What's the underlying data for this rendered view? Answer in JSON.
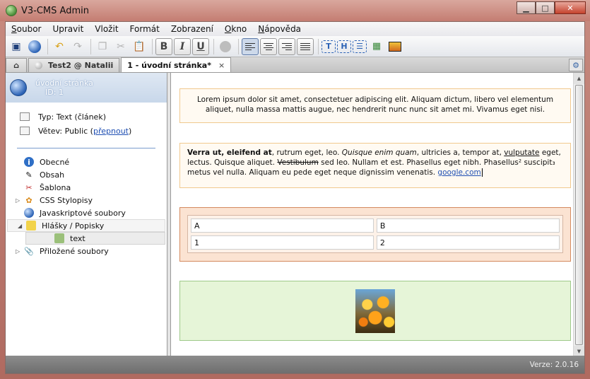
{
  "window": {
    "title": "V3-CMS Admin",
    "minimize": "▁",
    "maximize": "□",
    "close": "✕"
  },
  "menu": [
    {
      "pre": "S",
      "rest": "oubor"
    },
    {
      "pre": "",
      "rest": "Upravit"
    },
    {
      "pre": "",
      "rest": "Vložit"
    },
    {
      "pre": "",
      "rest": "Formát"
    },
    {
      "pre": "",
      "rest": "Zobrazení"
    },
    {
      "pre": "O",
      "rest": "kno"
    },
    {
      "pre": "N",
      "rest": "ápověda"
    }
  ],
  "toolbar": {
    "bold": "B",
    "italic": "I",
    "underline": "U",
    "icons": [
      "save-icon",
      "publish-icon",
      "undo-icon",
      "redo-icon",
      "copy-icon",
      "cut-icon",
      "paste-icon",
      "bold-icon",
      "italic-icon",
      "underline-icon",
      "link-icon",
      "align-left-icon",
      "align-center-icon",
      "align-right-icon",
      "align-justify-icon",
      "insert-text-block-icon",
      "insert-heading-block-icon",
      "insert-list-block-icon",
      "insert-table-icon",
      "insert-image-icon"
    ]
  },
  "tabs": [
    {
      "label": "Test2 @ Natalii",
      "active": false
    },
    {
      "label": "1 - úvodní stránka*",
      "active": true
    }
  ],
  "tab_close": "×",
  "sidebar": {
    "page_title": "úvodní stránka",
    "page_id": "ID: 1",
    "type_label": "Typ: Text (článek)",
    "branch_label": "Větev: Public (",
    "branch_link": "přepnout",
    "branch_end": ")",
    "tree": [
      {
        "label": "Obecné",
        "icon": "info-icon"
      },
      {
        "label": "Obsah",
        "icon": "pencil-icon"
      },
      {
        "label": "Šablona",
        "icon": "template-icon"
      },
      {
        "label": "CSS Stylopisy",
        "icon": "css-icon"
      },
      {
        "label": "Javaskriptové soubory",
        "icon": "globe-icon"
      },
      {
        "label": "Hlášky / Popisky",
        "icon": "folder-icon"
      },
      {
        "label": "text",
        "icon": "leaf-icon"
      },
      {
        "label": "Přiložené soubory",
        "icon": "paperclip-icon"
      }
    ]
  },
  "content": {
    "block1": "Lorem ipsum dolor sit amet, consectetuer adipiscing elit. Aliquam dictum, libero vel elementum aliquet, nulla massa mattis augue, nec hendrerit nunc nunc sit amet mi. Vivamus eget nisi.",
    "block2": {
      "bold": "Verra ut, eleifend at",
      "t1": ", rutrum eget, leo. ",
      "italic": "Quisque enim quam",
      "t2": ", ultricies a, tempor at, ",
      "underlined": "vulputate",
      "t3": " eget, lectus. Quisque aliquet. ",
      "strike": "Vestibulum",
      "t4": " sed leo. Nullam et est. Phasellus eget nibh. Phasellus² suscipit₃ metus vel nulla. Aliquam eu pede eget neque dignissim venenatis. ",
      "link": "google.com"
    },
    "table": [
      [
        "A",
        "B"
      ],
      [
        "1",
        "2"
      ]
    ]
  },
  "status": {
    "version": "Verze: 2.0.16"
  },
  "colors": {
    "accent": "#2b62b5",
    "frame": "#c47d72"
  }
}
